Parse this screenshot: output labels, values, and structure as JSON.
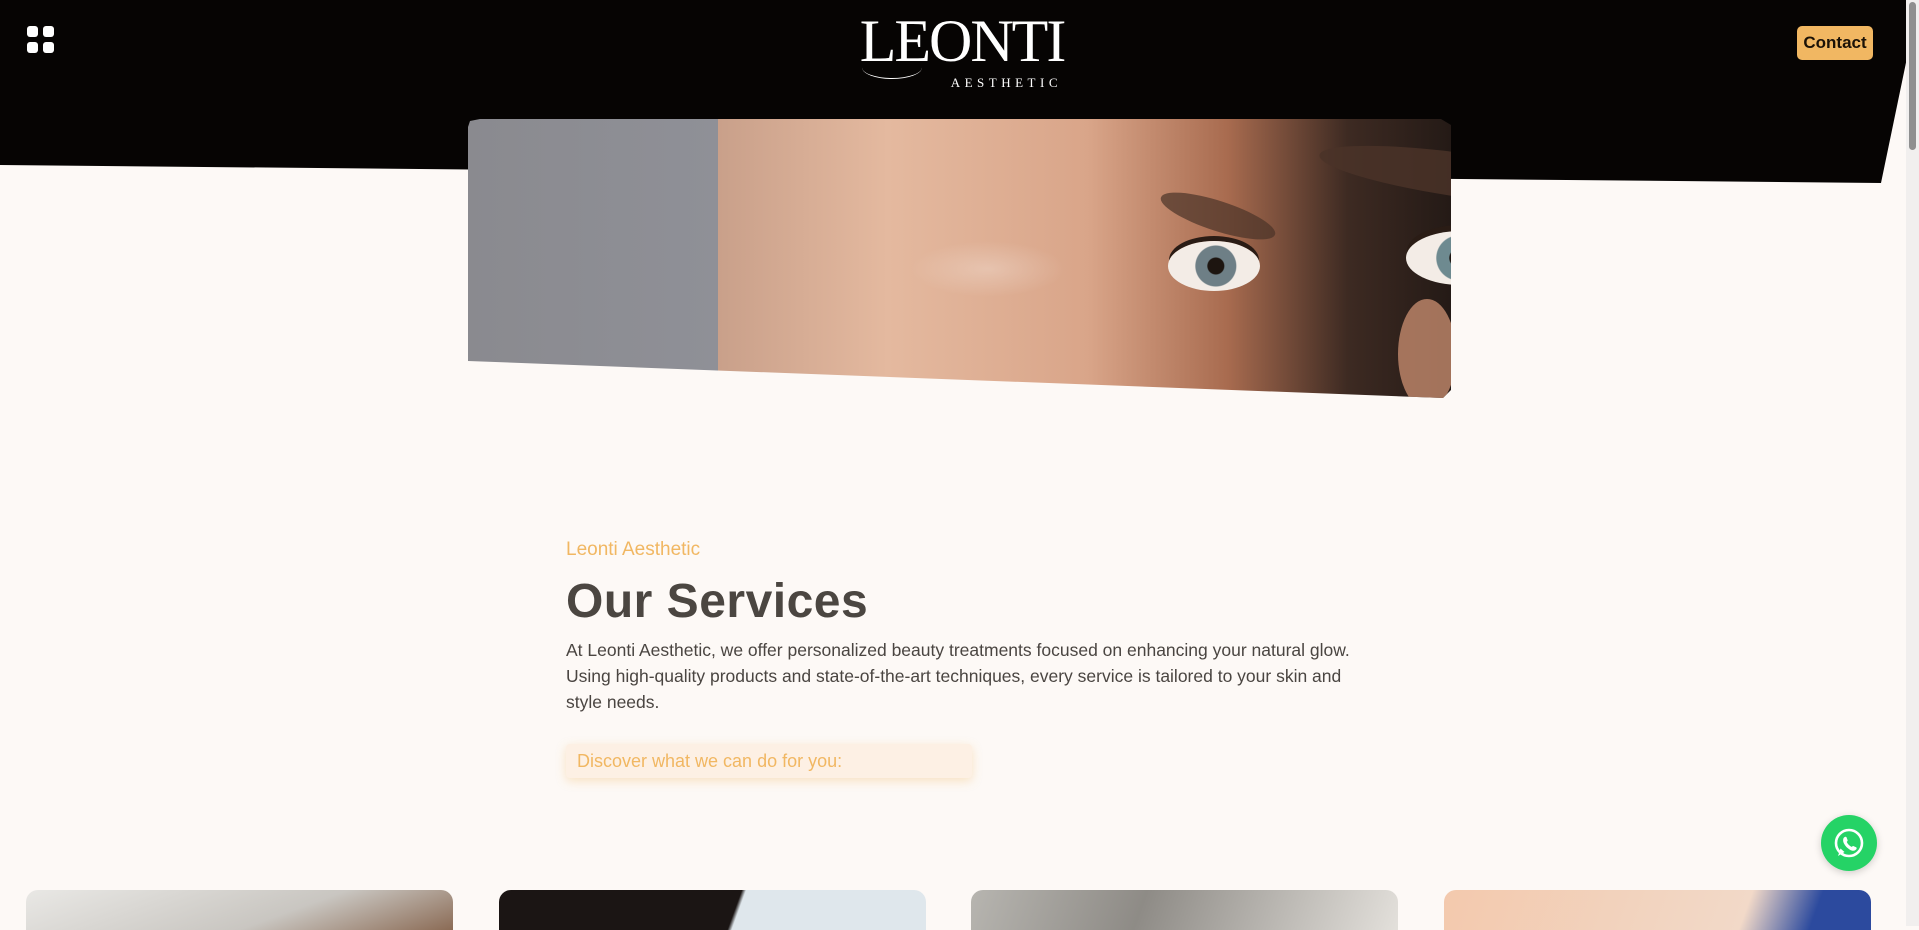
{
  "header": {
    "logo": {
      "main": "LEONTI",
      "sub": "AESTHETIC"
    },
    "contact_label": "Contact",
    "menu_icon": "grid-menu-icon"
  },
  "hero": {
    "image_description": "close-up of woman's eyes with long lashes"
  },
  "intro": {
    "kicker": "Leonti Aesthetic",
    "title": "Our Services",
    "description": "At Leonti Aesthetic, we offer personalized beauty treatments focused on enhancing your natural glow. Using high-quality products and state-of-the-art techniques, every service is tailored to your skin and style needs.",
    "discover": "Discover what we can do for you:"
  },
  "whatsapp": {
    "icon": "whatsapp-icon"
  },
  "colors": {
    "accent": "#f1b762",
    "header_bg": "#060403",
    "page_bg": "#fdf9f6",
    "heading": "#4b4641",
    "whatsapp": "#25d366"
  }
}
